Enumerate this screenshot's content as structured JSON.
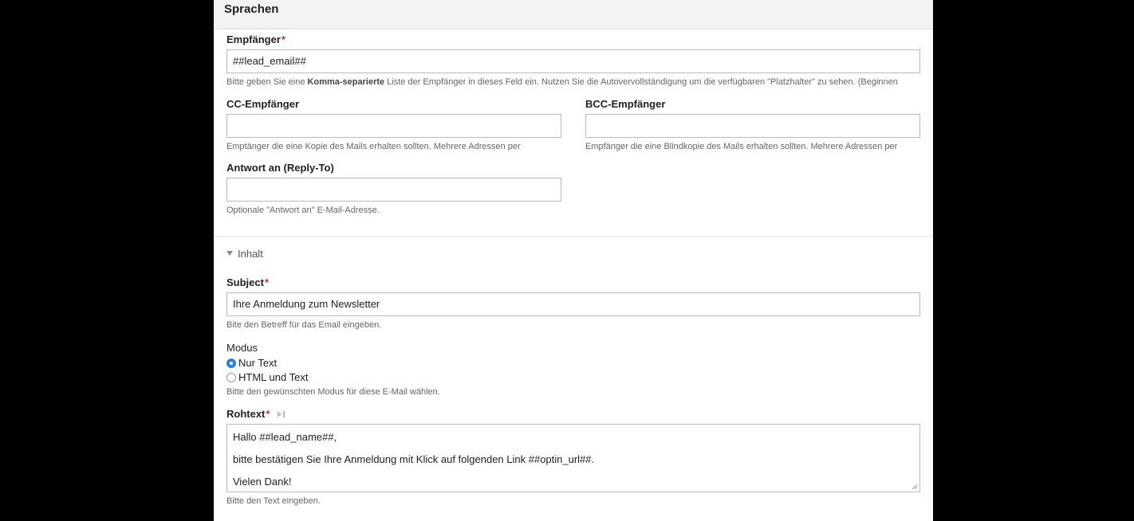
{
  "section": {
    "title": "Sprachen"
  },
  "recipients": {
    "label": "Empfänger",
    "required_mark": "*",
    "value": "##lead_email##",
    "help_before": "Bitte geben Sie eine ",
    "help_bold": "Komma-separierte",
    "help_after": " Liste der Empfänger in dieses Feld ein. Nutzen Sie die Autovervollständigung um die verfügbaren \"Platzhalter\" zu sehen. (Beginnen"
  },
  "cc": {
    "label": "CC-Empfänger",
    "value": "",
    "help": "Emptänger die eine Kopie des Mails erhalten sollten. Mehrere Adressen per"
  },
  "bcc": {
    "label": "BCC-Empfänger",
    "value": "",
    "help": "Empfänger die eine Blindkopie des Mails erhalten sollten. Mehrere Adressen per"
  },
  "reply_to": {
    "label": "Antwort an (Reply-To)",
    "value": "",
    "help": "Optionale \"Antwort an\" E-Mail-Adresse."
  },
  "content_group": {
    "legend": "Inhalt",
    "toggle_icon": "triangle-down-icon"
  },
  "subject": {
    "label": "Subject",
    "required_mark": "*",
    "value": "Ihre Anmeldung zum Newsletter",
    "help": "Bite den Betreff für das Email eingeben."
  },
  "mode": {
    "label": "Modus",
    "options": [
      {
        "label": "Nur Text",
        "checked": true
      },
      {
        "label": "HTML und Text",
        "checked": false
      }
    ],
    "help": "Bitte den gewünschten Modus für diese E-Mail wählen."
  },
  "raw_text": {
    "label": "Rohtext",
    "required_mark": "*",
    "lines": [
      "Hallo ##lead_name##,",
      "bitte bestätigen Sie Ihre Anmeldung mit Klick auf folgenden Link ##optin_url##.",
      "Vielen Dank!"
    ],
    "help": "Bitte den Text eingeben."
  },
  "colors": {
    "accent": "#2b7fe0",
    "required": "#cc3333",
    "border": "#bbbbbb"
  }
}
